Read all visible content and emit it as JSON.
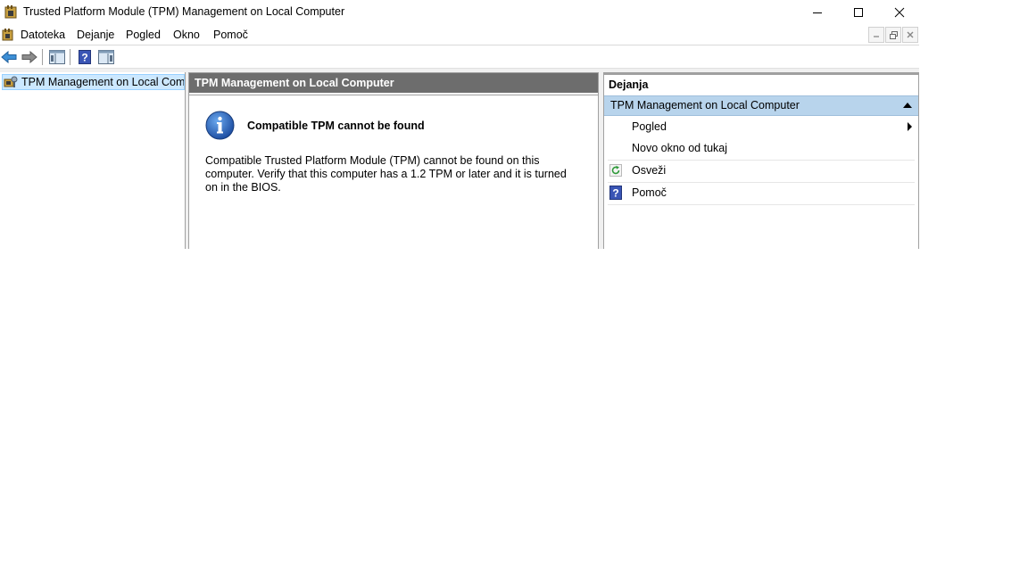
{
  "window": {
    "title": "Trusted Platform Module (TPM) Management on Local Computer",
    "controls": [
      "minimize-icon",
      "maximize-icon",
      "close-icon"
    ]
  },
  "menu": {
    "items": [
      "Datoteka",
      "Dejanje",
      "Pogled",
      "Okno",
      "Pomoč"
    ]
  },
  "toolbar": {
    "buttons": [
      "back-arrow-icon",
      "forward-arrow-icon",
      "show-hide-console-tree-icon",
      "help-icon",
      "show-hide-action-pane-icon"
    ]
  },
  "tree": {
    "item_label": "TPM Management on Local Comp"
  },
  "center": {
    "header": "TPM Management on Local Computer",
    "message_title": "Compatible TPM cannot be found",
    "message_body": "Compatible Trusted Platform Module (TPM) cannot be found on this computer. Verify that this computer has a 1.2 TPM or later and it is turned on in the BIOS."
  },
  "actions": {
    "header": "Dejanja",
    "section_title": "TPM Management on Local Computer",
    "items": [
      {
        "label": "Pogled",
        "icon": "",
        "submenu": true
      },
      {
        "label": "Novo okno od tukaj",
        "icon": ""
      },
      {
        "label": "Osveži",
        "icon": "refresh-icon"
      },
      {
        "label": "Pomoč",
        "icon": "help-icon"
      }
    ]
  },
  "colors": {
    "selection": "#cce8ff",
    "section_bar": "#b8d4ec",
    "center_header": "#6d6d6d",
    "info_icon": "#1e5fb8"
  }
}
